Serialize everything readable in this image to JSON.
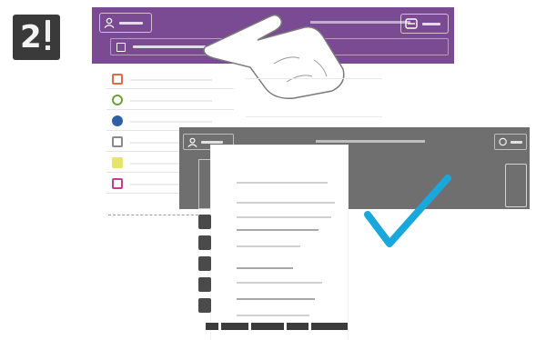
{
  "step": {
    "number": "2"
  },
  "colors": {
    "screen_top": "#7a4a93",
    "screen_second": "#6f6f6f",
    "check": "#1aa7dc"
  },
  "icons": {
    "user": "user-icon",
    "logout": "logout-icon",
    "folder": "folder-icon",
    "close": "close-icon",
    "hand": "hand-pointer-icon",
    "check": "checkmark-icon"
  },
  "app_list": {
    "items": [
      {
        "icon": "document-icon",
        "color": "#e06b4a"
      },
      {
        "icon": "link-icon",
        "color": "#6a9f3a"
      },
      {
        "icon": "app-blue-icon",
        "color": "#2f5fa8"
      },
      {
        "icon": "grid-icon",
        "color": "#8a8a8a"
      },
      {
        "icon": "app-yellow-icon",
        "color": "#d4cf3a"
      },
      {
        "icon": "app-magenta-icon",
        "color": "#c2418f"
      }
    ]
  }
}
